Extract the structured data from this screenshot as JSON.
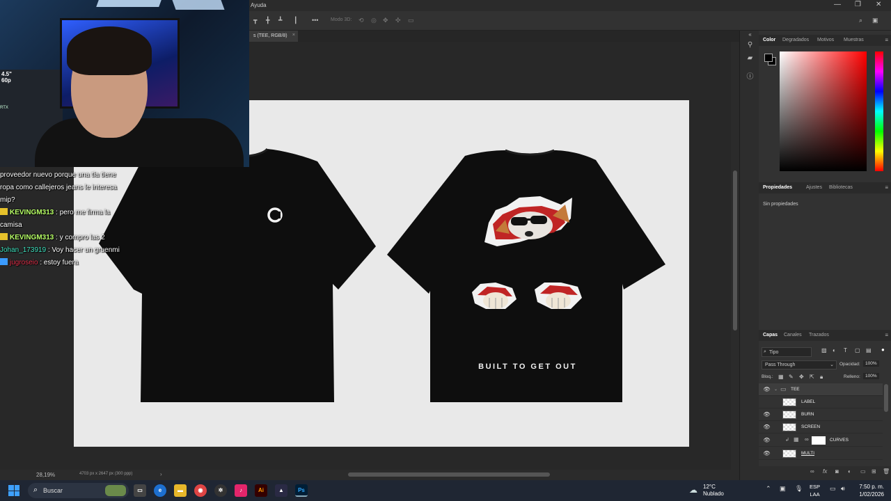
{
  "menubar": {
    "help_menu": "Ayuda",
    "minimize": "—",
    "restore": "❐",
    "close": "✕"
  },
  "optbar": {
    "mode_3d": "Modo 3D:",
    "more": "•••"
  },
  "document": {
    "tab_label": "s (TEE, RGB/8)",
    "tab_close": "×",
    "zoom": "28,19%",
    "doc_info": "4703 px x 2647 px (300 ppp)",
    "chevron": "›"
  },
  "shirt": {
    "back_text": "BUILT TO GET OUT"
  },
  "panels": {
    "color_tabs": [
      "Color",
      "Degradados",
      "Motivos",
      "Muestras"
    ],
    "props_tabs": [
      "Propiedades",
      "Ajustes",
      "Bibliotecas"
    ],
    "props_empty": "Sin propiedades",
    "layer_tabs": [
      "Capas",
      "Canales",
      "Trazados"
    ],
    "kind_filter": "Tipo",
    "blend_mode": "Pass Through",
    "opacity_label": "Opacidad:",
    "opacity_value": "100%",
    "lock_label": "Bloq.:",
    "fill_label": "Relleno:",
    "fill_value": "100%",
    "layers": [
      {
        "name": "TEE",
        "visible": true
      },
      {
        "name": "LABEL",
        "visible": false
      },
      {
        "name": "BURN",
        "visible": true
      },
      {
        "name": "SCREEN",
        "visible": true
      },
      {
        "name": "CURVES",
        "visible": true
      },
      {
        "name": "MULTI",
        "visible": true
      }
    ]
  },
  "webcam": {
    "overlay_top": "4.5\"",
    "overlay_bottom": "60p",
    "rtx": "RTX"
  },
  "chat": {
    "messages": [
      {
        "user": "",
        "text": "proveedor nuevo porque una tía tiene"
      },
      {
        "user": "",
        "text": "ropa como callejeros jeans le interesa"
      },
      {
        "user": "",
        "text": "mip?"
      },
      {
        "user": "KEVINGM313",
        "text": " : pero me firma la"
      },
      {
        "user": "",
        "text": "camisa"
      },
      {
        "user": "KEVINGM313",
        "text": " : y compro las 2"
      },
      {
        "user": "Johan_173919",
        "text": " : Voy hacer un gruenmi"
      },
      {
        "user": "jugroseio",
        "text": " : estoy fuera"
      }
    ]
  },
  "taskbar": {
    "search_placeholder": "Buscar",
    "weather_temp": "12°C",
    "weather_desc": "Nublado",
    "lang_1": "ESP",
    "lang_2": "LAA",
    "time": "7:50 p. m.",
    "date": "1/02/2026",
    "apps": [
      "Ai",
      "Ps"
    ]
  },
  "colors": {
    "ps_bg": "#282828",
    "artboard": "#e9e9e9",
    "shirt": "#0e0e0e",
    "accent_blue": "#3ea0ff",
    "ps_blue": "#31a8ff",
    "ai_orange": "#ff9a00"
  }
}
